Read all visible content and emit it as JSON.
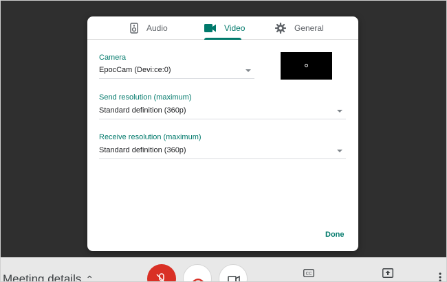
{
  "dialog": {
    "tabs": [
      {
        "label": "Audio",
        "icon": "speaker-icon",
        "selected": false
      },
      {
        "label": "Video",
        "icon": "video-camera-icon",
        "selected": true
      },
      {
        "label": "General",
        "icon": "gear-icon",
        "selected": false
      }
    ],
    "camera": {
      "label": "Camera",
      "value": "EpocCam (Devi:ce:0)"
    },
    "send_resolution": {
      "label": "Send resolution (maximum)",
      "value": "Standard definition (360p)"
    },
    "receive_resolution": {
      "label": "Receive resolution (maximum)",
      "value": "Standard definition (360p)"
    },
    "done_label": "Done"
  },
  "call_bar": {
    "meeting_details_label": "Meeting details",
    "icons": [
      "microphone-off-icon",
      "hang-up-icon",
      "video-camera-icon",
      "closed-captions-icon",
      "present-screen-icon",
      "more-vert-icon"
    ]
  },
  "colors": {
    "accent": "#00796b",
    "mic_off_red": "#d93025",
    "backdrop": "#2f2f2f"
  }
}
